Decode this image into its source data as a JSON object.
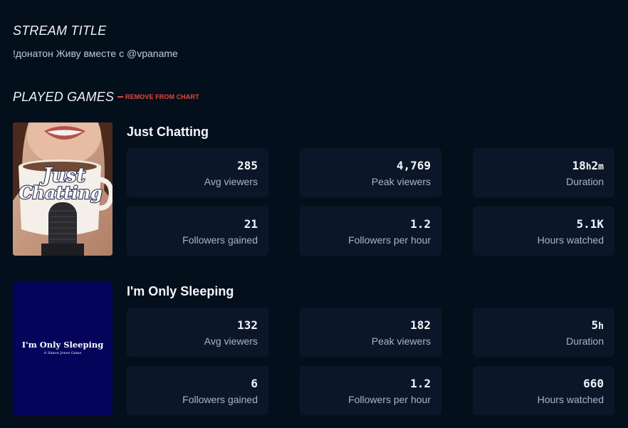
{
  "stream": {
    "heading": "STREAM TITLE",
    "title": "!донатон Живу вместе с @vpaname"
  },
  "played_games": {
    "heading": "PLAYED GAMES",
    "remove_label": "REMOVE FROM CHART"
  },
  "games": [
    {
      "name": "Just Chatting",
      "cover_text": "Just Chatting",
      "stats": {
        "avg_viewers": {
          "value": "285",
          "label": "Avg viewers"
        },
        "peak_viewers": {
          "value": "4,769",
          "label": "Peak viewers"
        },
        "duration": {
          "hours": "18",
          "h_unit": "h",
          "minutes": "2",
          "m_unit": "m",
          "label": "Duration"
        },
        "followers_gained": {
          "value": "21",
          "label": "Followers gained"
        },
        "followers_per_hour": {
          "value": "1.2",
          "label": "Followers per hour"
        },
        "hours_watched": {
          "value": "5.1K",
          "label": "Hours watched"
        }
      }
    },
    {
      "name": "I'm Only Sleeping",
      "cover_title": "I'm Only Sleeping",
      "cover_subtitle": "A Simon Jones Game",
      "stats": {
        "avg_viewers": {
          "value": "132",
          "label": "Avg viewers"
        },
        "peak_viewers": {
          "value": "182",
          "label": "Peak viewers"
        },
        "duration": {
          "hours": "5",
          "h_unit": "h",
          "label": "Duration"
        },
        "followers_gained": {
          "value": "6",
          "label": "Followers gained"
        },
        "followers_per_hour": {
          "value": "1.2",
          "label": "Followers per hour"
        },
        "hours_watched": {
          "value": "660",
          "label": "Hours watched"
        }
      }
    }
  ],
  "colors": {
    "background": "#040f1c",
    "card": "#0b1729",
    "accent_red": "#e5463c",
    "sleeping_cover": "#03045a"
  }
}
